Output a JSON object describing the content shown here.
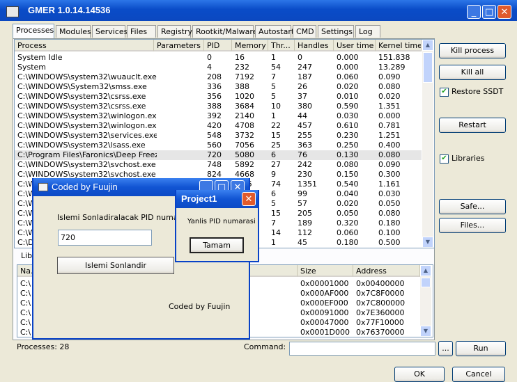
{
  "window": {
    "title": "GMER 1.0.14.14536"
  },
  "tabs": [
    "Processes",
    "Modules",
    "Services",
    "Files",
    "Registry",
    "Rootkit/Malware",
    "Autostart",
    "CMD",
    "Settings",
    "Log"
  ],
  "process_list": {
    "columns": [
      "Process",
      "Parameters",
      "PID",
      "Memory",
      "Thr...",
      "Handles",
      "User time",
      "Kernel time"
    ],
    "rows": [
      [
        "System Idle",
        "",
        "0",
        "16",
        "1",
        "0",
        "0.000",
        "151.838"
      ],
      [
        "System",
        "",
        "4",
        "232",
        "54",
        "247",
        "0.000",
        "13.289"
      ],
      [
        "C:\\WINDOWS\\system32\\wuauclt.exe",
        "",
        "208",
        "7192",
        "7",
        "187",
        "0.060",
        "0.090"
      ],
      [
        "C:\\WINDOWS\\System32\\smss.exe",
        "",
        "336",
        "388",
        "5",
        "26",
        "0.020",
        "0.080"
      ],
      [
        "C:\\WINDOWS\\system32\\csrss.exe",
        "",
        "356",
        "1020",
        "5",
        "37",
        "0.010",
        "0.020"
      ],
      [
        "C:\\WINDOWS\\system32\\csrss.exe",
        "",
        "388",
        "3684",
        "10",
        "380",
        "0.590",
        "1.351"
      ],
      [
        "C:\\WINDOWS\\system32\\winlogon.exe",
        "",
        "392",
        "2140",
        "1",
        "44",
        "0.030",
        "0.000"
      ],
      [
        "C:\\WINDOWS\\system32\\winlogon.exe",
        "",
        "420",
        "4708",
        "22",
        "457",
        "0.610",
        "0.781"
      ],
      [
        "C:\\WINDOWS\\system32\\services.exe",
        "",
        "548",
        "3732",
        "15",
        "255",
        "0.230",
        "1.251"
      ],
      [
        "C:\\WINDOWS\\system32\\lsass.exe",
        "",
        "560",
        "7056",
        "25",
        "363",
        "0.250",
        "0.400"
      ],
      [
        "C:\\Program Files\\Faronics\\Deep Freez...",
        "",
        "720",
        "5080",
        "6",
        "76",
        "0.130",
        "0.080"
      ],
      [
        "C:\\WINDOWS\\system32\\svchost.exe",
        "",
        "748",
        "5892",
        "27",
        "242",
        "0.080",
        "0.090"
      ],
      [
        "C:\\WINDOWS\\system32\\svchost.exe",
        "",
        "824",
        "4668",
        "9",
        "230",
        "0.150",
        "0.300"
      ],
      [
        "C:\\W",
        "",
        "",
        "...36",
        "74",
        "1351",
        "0.540",
        "1.161"
      ],
      [
        "C:\\W",
        "",
        "",
        "",
        "6",
        "99",
        "0.040",
        "0.030"
      ],
      [
        "C:\\W",
        "",
        "",
        "",
        "5",
        "57",
        "0.020",
        "0.050"
      ],
      [
        "C:\\W",
        "",
        "",
        "",
        "15",
        "205",
        "0.050",
        "0.080"
      ],
      [
        "C:\\W",
        "",
        "",
        "",
        "7",
        "189",
        "0.320",
        "0.180"
      ],
      [
        "C:\\W",
        "",
        "",
        "",
        "14",
        "112",
        "0.060",
        "0.100"
      ],
      [
        "C:\\D",
        "",
        "",
        "",
        "1",
        "45",
        "0.180",
        "0.500"
      ]
    ],
    "selected_index": 10
  },
  "libraries": {
    "header_label": "Libra...",
    "columns": [
      "Na...",
      "Size",
      "Address"
    ],
    "rows": [
      [
        "C:\\",
        "0x00001000",
        "0x00400000"
      ],
      [
        "C:\\",
        "0x000AF000",
        "0x7C8F0000"
      ],
      [
        "C:\\",
        "0x000EF000",
        "0x7C800000"
      ],
      [
        "C:\\",
        "0x00091000",
        "0x7E360000"
      ],
      [
        "C:\\",
        "0x00047000",
        "0x77F10000"
      ],
      [
        "C:\\",
        "0x0001D000",
        "0x76370000"
      ]
    ]
  },
  "right_panel": {
    "kill_process": "Kill process",
    "kill_all": "Kill all",
    "restore_ssdt": "Restore SSDT",
    "restart": "Restart",
    "libraries": "Libraries",
    "safe": "Safe...",
    "files": "Files..."
  },
  "status": {
    "processes": "Processes: 28",
    "command_label": "Command:",
    "browse": "...",
    "run": "Run"
  },
  "footer": {
    "ok": "OK",
    "cancel": "Cancel"
  },
  "coded_dialog": {
    "title": "Coded by Fuujin",
    "prompt": "Islemi Sonladiralacak PID numarasini",
    "pid_value": "720",
    "button": "Islemi Sonlandir",
    "credit": "Coded by Fuujin"
  },
  "message_box": {
    "title": "Project1",
    "message": "Yanlis PID numarasi",
    "ok": "Tamam"
  }
}
